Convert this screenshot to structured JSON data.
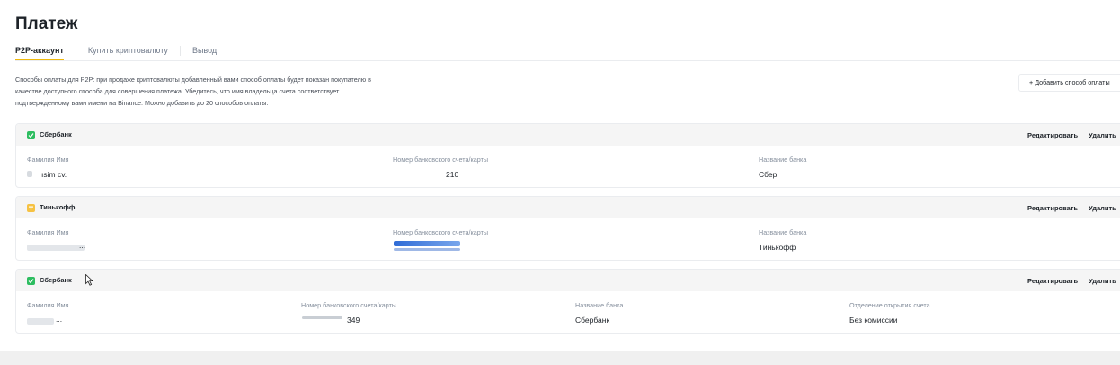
{
  "page": {
    "title": "Платеж",
    "tabs": [
      {
        "label": "P2P-аккаунт",
        "active": true
      },
      {
        "label": "Купить криптовалюту",
        "active": false
      },
      {
        "label": "Вывод",
        "active": false
      }
    ],
    "description": "Способы оплаты для P2P: при продаже криптовалюты добавленный вами способ оплаты будет показан покупателю в качестве доступного способа для совершения платежа. Убедитесь, что имя владельца счета соответствует подтвержденному вами имени на Binance. Можно добавить до 20 способов оплаты.",
    "add_button": "+ Добавить способ оплаты"
  },
  "cards": [
    {
      "name": "Сбербанк",
      "icon": "sberbank-icon",
      "icon_color": "#2dbd60",
      "edit_label": "Редактировать",
      "delete_label": "Удалить",
      "fields": [
        {
          "label": "Фамилия Имя",
          "value": "ısim cv."
        },
        {
          "label": "Номер банковского счета/карты",
          "value": "210"
        },
        {
          "label": "Название банка",
          "value": "Сбер"
        }
      ]
    },
    {
      "name": "Тинькофф",
      "icon": "tinkoff-icon",
      "icon_color": "#f6c243",
      "edit_label": "Редактировать",
      "delete_label": "Удалить",
      "fields": [
        {
          "label": "Фамилия Имя",
          "value": "..."
        },
        {
          "label": "Номер банковского счета/карты",
          "value": ""
        },
        {
          "label": "Название банка",
          "value": "Тинькофф"
        }
      ]
    },
    {
      "name": "Сбербанк",
      "icon": "sberbank-icon",
      "icon_color": "#2dbd60",
      "edit_label": "Редактировать",
      "delete_label": "Удалить",
      "fields": [
        {
          "label": "Фамилия Имя",
          "value": "..."
        },
        {
          "label": "Номер банковского счета/карты",
          "value": "349"
        },
        {
          "label": "Название банка",
          "value": "Сбербанк"
        },
        {
          "label": "Отделение открытия счета",
          "value": "Без комиссии"
        }
      ]
    }
  ],
  "colors": {
    "accent": "#f0b90b",
    "text": "#1e2329",
    "muted": "#848e9c"
  }
}
